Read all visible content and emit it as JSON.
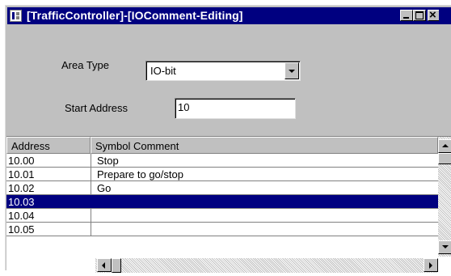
{
  "window": {
    "title": "[TrafficController]-[IOComment-Editing]",
    "icons": {
      "app": "plc-editor-icon",
      "minimize": "minimize-icon",
      "maximize": "maximize-icon",
      "close": "close-icon"
    }
  },
  "form": {
    "area_type_label": "Area Type",
    "area_type_value": "IO-bit",
    "start_address_label": "Start Address",
    "start_address_value": "10"
  },
  "table": {
    "columns": [
      "Address",
      "Symbol Comment"
    ],
    "rows": [
      {
        "address": "10.00",
        "comment": "Stop"
      },
      {
        "address": "10.01",
        "comment": "Prepare to go/stop"
      },
      {
        "address": "10.02",
        "comment": "Go"
      },
      {
        "address": "10.03",
        "comment": "",
        "selected": true
      },
      {
        "address": "10.04",
        "comment": ""
      },
      {
        "address": "10.05",
        "comment": ""
      }
    ]
  },
  "colors": {
    "title_bar": "#000080",
    "selection": "#000080",
    "face": "#c0c0c0"
  }
}
